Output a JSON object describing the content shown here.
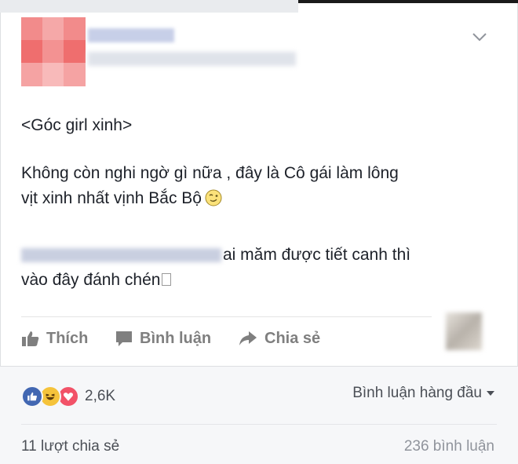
{
  "post": {
    "lines": {
      "l1": "<Góc girl xinh>",
      "l2": "Không còn nghi ngờ gì nữa , đây là Cô gái làm lông",
      "l3": "vịt xinh nhất vịnh Bắc Bộ",
      "l4": "ai măm được tiết canh thì",
      "l5": "vào đây đánh chén"
    }
  },
  "actions": {
    "like": "Thích",
    "comment": "Bình luận",
    "share": "Chia sẻ"
  },
  "reactions": {
    "count": "2,6K",
    "icons": [
      "like-reaction-icon",
      "haha-reaction-icon",
      "love-reaction-icon"
    ]
  },
  "sort": {
    "label": "Bình luận hàng đầu"
  },
  "stats": {
    "shares": "11 lượt chia sẻ",
    "comments": "236 bình luận"
  },
  "colors": {
    "like": "#4267b2",
    "haha": "#f5c33b",
    "love": "#f25268",
    "action_grey": "#7f7f7f"
  }
}
